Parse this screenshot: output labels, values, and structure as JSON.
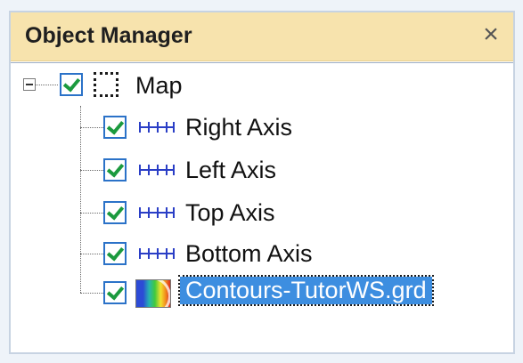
{
  "panel": {
    "title": "Object Manager",
    "close_glyph": "×"
  },
  "tree": {
    "root": {
      "label": "Map",
      "checked": true,
      "expanded": true,
      "icon": "map-frame-icon"
    },
    "children": [
      {
        "label": "Right Axis",
        "checked": true,
        "icon": "axis-icon"
      },
      {
        "label": "Left Axis",
        "checked": true,
        "icon": "axis-icon"
      },
      {
        "label": "Top Axis",
        "checked": true,
        "icon": "axis-icon"
      },
      {
        "label": "Bottom Axis",
        "checked": true,
        "icon": "axis-icon"
      },
      {
        "label": "Contours-TutorWS.grd",
        "checked": true,
        "icon": "contour-map-icon",
        "selected": true
      }
    ]
  },
  "colors": {
    "title_bar": "#f7e3ad",
    "selection": "#3d8ee0",
    "checkbox_border": "#2b72c8",
    "checkmark": "#1b9a3e",
    "axis_icon": "#2a3ec6"
  }
}
